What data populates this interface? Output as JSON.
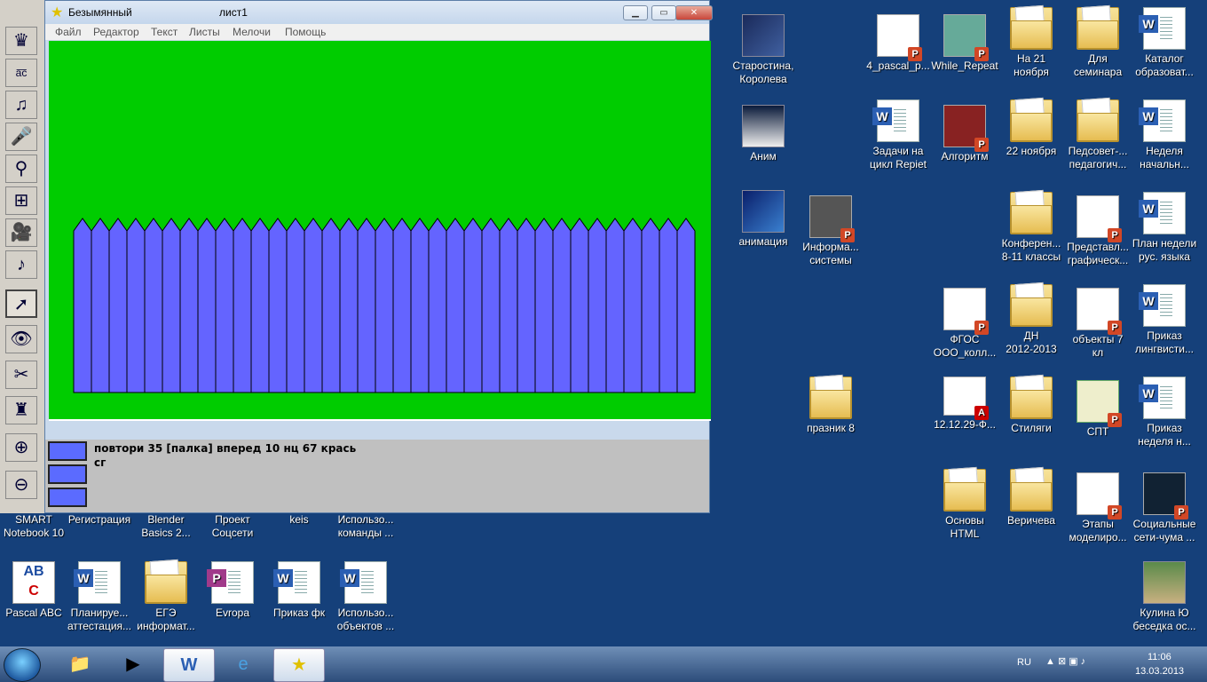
{
  "window": {
    "title": "Безымянный",
    "sheet": "лист1",
    "menu": [
      "Файл",
      "Редактор",
      "Текст",
      "Листы",
      "Мелочи",
      "Помощь"
    ],
    "command_line1": "повтори 35 [палка] вперед 10 нц 67 крась",
    "command_line2": "сг",
    "canvas_color": "#00cc00",
    "fence_color": "#6464ff"
  },
  "fence": {
    "pickets": 35
  },
  "desktop": {
    "icons": [
      {
        "label1": "Старостина,",
        "label2": "Королева",
        "type": "img"
      },
      {
        "label1": "4_pascal_p...",
        "label2": "",
        "type": "ppt"
      },
      {
        "label1": "While_Repeat",
        "label2": "",
        "type": "ppt"
      },
      {
        "label1": "На 21",
        "label2": "ноября",
        "type": "folder"
      },
      {
        "label1": "Для",
        "label2": "семинара",
        "type": "folder"
      },
      {
        "label1": "Каталог",
        "label2": "образоват...",
        "type": "word"
      },
      {
        "label1": "Аним",
        "label2": "",
        "type": "img"
      },
      {
        "label1": "Задачи на",
        "label2": "цикл Repiet",
        "type": "word"
      },
      {
        "label1": "Алгоритм",
        "label2": "",
        "type": "ppt"
      },
      {
        "label1": "22 ноября",
        "label2": "",
        "type": "folder"
      },
      {
        "label1": "Педсовет-...",
        "label2": "педагогич...",
        "type": "folder"
      },
      {
        "label1": "Неделя",
        "label2": "начальн...",
        "type": "word"
      },
      {
        "label1": "анимация",
        "label2": "",
        "type": "img"
      },
      {
        "label1": "Информа...",
        "label2": "системы",
        "type": "ppt"
      },
      {
        "label1": "Конферен...",
        "label2": "8-11 классы",
        "type": "folder"
      },
      {
        "label1": "Представл...",
        "label2": "графическ...",
        "type": "ppt"
      },
      {
        "label1": "План недели",
        "label2": "рус. языка",
        "type": "word"
      },
      {
        "label1": "ФГОС",
        "label2": "ООО_колл...",
        "type": "ppt"
      },
      {
        "label1": "ДН",
        "label2": "2012-2013",
        "type": "folder"
      },
      {
        "label1": "объекты 7",
        "label2": "кл",
        "type": "ppt"
      },
      {
        "label1": "Приказ",
        "label2": "лингвисти...",
        "type": "word"
      },
      {
        "label1": "празник 8",
        "label2": "",
        "type": "folder"
      },
      {
        "label1": "12.12.29-Ф...",
        "label2": "",
        "type": "pdf"
      },
      {
        "label1": "Стиляги",
        "label2": "",
        "type": "folder"
      },
      {
        "label1": "СПТ",
        "label2": "",
        "type": "ppt"
      },
      {
        "label1": "Приказ",
        "label2": "неделя н...",
        "type": "word"
      },
      {
        "label1": "SMART",
        "label2": "Notebook 10",
        "type": "none"
      },
      {
        "label1": "Регистрация",
        "label2": "",
        "type": "none"
      },
      {
        "label1": "Blender",
        "label2": "Basics 2...",
        "type": "none"
      },
      {
        "label1": "Проект",
        "label2": "Соцсети",
        "type": "none"
      },
      {
        "label1": "keis",
        "label2": "",
        "type": "none"
      },
      {
        "label1": "Использо...",
        "label2": "команды ...",
        "type": "none"
      },
      {
        "label1": "Основы",
        "label2": "HTML",
        "type": "folder"
      },
      {
        "label1": "Веричева",
        "label2": "",
        "type": "folder"
      },
      {
        "label1": "Этапы",
        "label2": "моделиро...",
        "type": "ppt"
      },
      {
        "label1": "Социальные",
        "label2": "сети-чума ...",
        "type": "ppt"
      },
      {
        "label1": "Pascal ABC",
        "label2": "",
        "type": "abc"
      },
      {
        "label1": "Планируе...",
        "label2": "аттестация...",
        "type": "word"
      },
      {
        "label1": "ЕГЭ",
        "label2": "информат...",
        "type": "folder"
      },
      {
        "label1": "Evropa",
        "label2": "",
        "type": "ppt"
      },
      {
        "label1": "Приказ фк",
        "label2": "",
        "type": "word"
      },
      {
        "label1": "Использо...",
        "label2": "объектов ...",
        "type": "word"
      },
      {
        "label1": "Кулина Ю",
        "label2": "беседка ос...",
        "type": "img"
      }
    ]
  },
  "taskbar": {
    "lang": "RU",
    "time": "11:06",
    "date": "13.03.2013"
  }
}
